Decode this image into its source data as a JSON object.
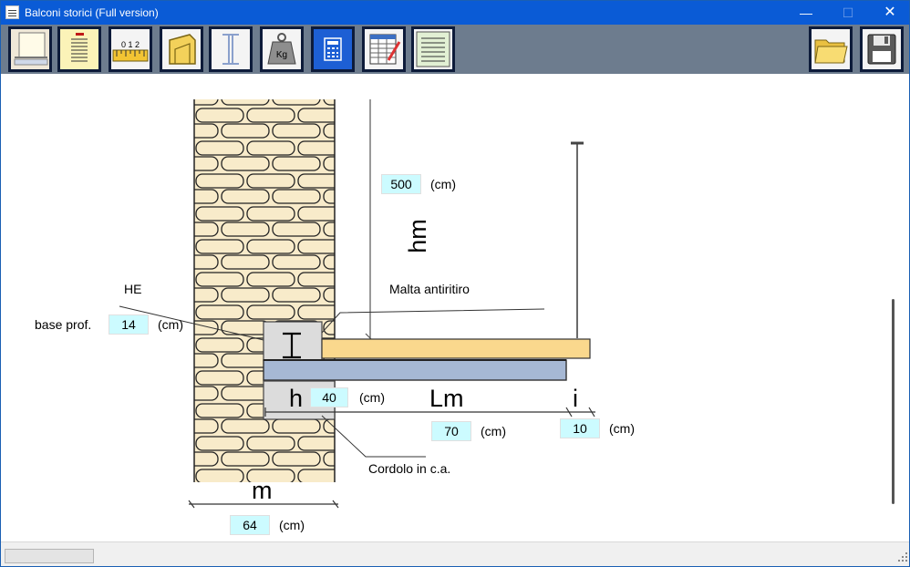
{
  "window": {
    "title": "Balconi storici (Full version)"
  },
  "window_controls": {
    "minimize": "—",
    "maximize": "☐",
    "close": "✕"
  },
  "toolbar": {
    "buttons": [
      {
        "icon": "wall-section-icon"
      },
      {
        "icon": "report-list-icon"
      },
      {
        "icon": "ruler-icon",
        "text": "0 1 2"
      },
      {
        "icon": "folder-shape-icon"
      },
      {
        "icon": "i-beam-icon"
      },
      {
        "icon": "weight-kg-icon",
        "text": "Kg"
      },
      {
        "icon": "calculator-icon",
        "active": true
      },
      {
        "icon": "spreadsheet-edit-icon"
      },
      {
        "icon": "notes-list-icon"
      }
    ],
    "right_buttons": [
      {
        "icon": "open-folder-icon"
      },
      {
        "icon": "save-disk-icon"
      }
    ]
  },
  "drawing": {
    "hm": {
      "value": "500",
      "unit": "(cm)",
      "label": "hm"
    },
    "he_label": "HE",
    "base_prof": {
      "label": "base prof.",
      "value": "14",
      "unit": "(cm)"
    },
    "malta_label": "Malta antiritiro",
    "h": {
      "label": "h",
      "value": "40",
      "unit": "(cm)"
    },
    "lm": {
      "label": "Lm",
      "value": "70",
      "unit": "(cm)"
    },
    "i": {
      "label": "i",
      "value": "10",
      "unit": "(cm)"
    },
    "cordolo_label": "Cordolo in c.a.",
    "m": {
      "label": "m",
      "value": "64",
      "unit": "(cm)"
    }
  },
  "colors": {
    "titlebar": "#0a5bd6",
    "toolbar": "#6d7c8e",
    "field_bg": "#ccfbff",
    "stone_fill": "#f8ebca",
    "slab_wood": "#fad88d",
    "beam_blue": "#a6b8d4",
    "cordolo_gray": "#dcdcdc"
  }
}
